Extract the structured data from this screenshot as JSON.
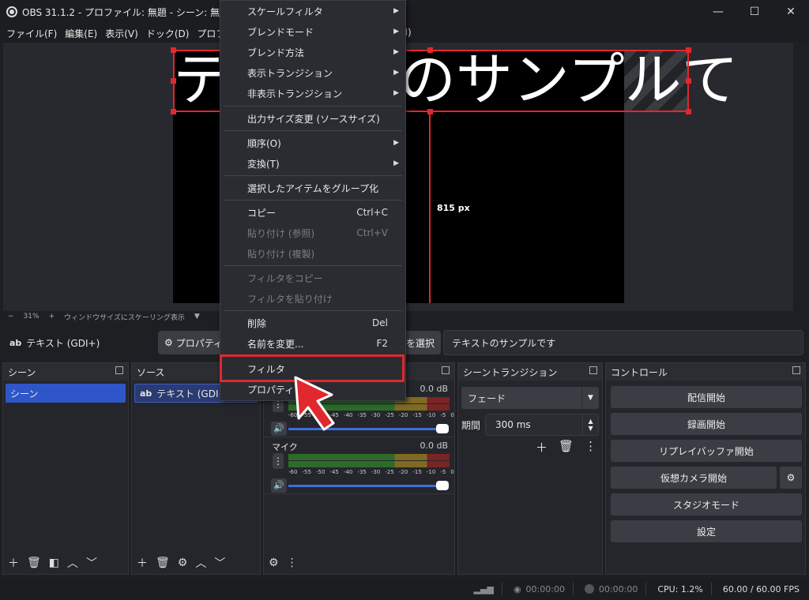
{
  "window": {
    "title": "OBS 31.1.2 - プロファイル: 無題 - シーン: 無題",
    "minimize": "—",
    "maximize": "☐",
    "close": "✕"
  },
  "menubar": {
    "items": [
      "ファイル(F)",
      "編集(E)",
      "表示(V)",
      "ドック(D)",
      "プロファイル"
    ],
    "trailing": "H)"
  },
  "preview": {
    "canvas_text": "テキストのサンプルて",
    "guide_label": "815 px"
  },
  "zoombar": {
    "minus": "−",
    "zoom": "31%",
    "plus": "+",
    "scale_mode": "ウィンドウサイズにスケーリング表示",
    "dropdown": "▼"
  },
  "source_toolbar": {
    "icon": "ab",
    "source_name": "テキスト (GDI+)",
    "properties": "プロパティ",
    "select_partial": "を選択",
    "text_value": "テキストのサンプルです"
  },
  "docks": {
    "scenes": {
      "title": "シーン",
      "items": [
        "シーン"
      ]
    },
    "sources": {
      "title": "ソース",
      "items": [
        {
          "icon": "ab",
          "label": "テキスト (GDI+)"
        }
      ]
    },
    "mixer": {
      "channels": [
        {
          "name": "",
          "db": "0.0 dB",
          "level": 0.0
        },
        {
          "name": "マイク",
          "db": "0.0 dB",
          "level": 0.0
        }
      ],
      "ticks": [
        "-60",
        "-55",
        "-50",
        "-45",
        "-40",
        "-35",
        "-30",
        "-25",
        "-20",
        "-15",
        "-10",
        "-5",
        "0"
      ]
    },
    "transitions": {
      "title": "シーントランジション",
      "transition": "フェード",
      "duration_label": "期間",
      "duration": "300 ms"
    },
    "controls": {
      "title": "コントロール",
      "buttons": [
        "配信開始",
        "録画開始",
        "リプレイバッファ開始",
        "仮想カメラ開始",
        "スタジオモード",
        "設定"
      ]
    }
  },
  "statusbar": {
    "stream_time": "00:00:00",
    "record_time": "00:00:00",
    "cpu": "CPU: 1.2%",
    "fps": "60.00 / 60.00 FPS"
  },
  "context_menu": {
    "items": [
      {
        "label": "スケールフィルタ",
        "submenu": true,
        "enabled": true
      },
      {
        "label": "ブレンドモード",
        "submenu": true,
        "enabled": true
      },
      {
        "label": "ブレンド方法",
        "submenu": true,
        "enabled": true
      },
      {
        "label": "表示トランジション",
        "submenu": true,
        "enabled": true
      },
      {
        "label": "非表示トランジション",
        "submenu": true,
        "enabled": true
      },
      {
        "label": "出力サイズ変更 (ソースサイズ)",
        "enabled": true
      },
      {
        "label": "順序(O)",
        "submenu": true,
        "enabled": true
      },
      {
        "label": "変換(T)",
        "submenu": true,
        "enabled": true
      },
      {
        "label": "選択したアイテムをグループ化",
        "enabled": true
      },
      {
        "label": "コピー",
        "shortcut": "Ctrl+C",
        "enabled": true
      },
      {
        "label": "貼り付け (参照)",
        "shortcut": "Ctrl+V",
        "enabled": false
      },
      {
        "label": "貼り付け (複製)",
        "enabled": false
      },
      {
        "label": "フィルタをコピー",
        "enabled": false
      },
      {
        "label": "フィルタを貼り付け",
        "enabled": false
      },
      {
        "label": "削除",
        "shortcut": "Del",
        "enabled": true
      },
      {
        "label": "名前を変更...",
        "shortcut": "F2",
        "enabled": true
      },
      {
        "label": "フィルタ",
        "enabled": true,
        "highlighted": true
      },
      {
        "label": "プロパティ",
        "enabled": true
      }
    ]
  },
  "colors": {
    "accent_selection": "#2f56c8",
    "highlight_red": "#e0282e"
  }
}
